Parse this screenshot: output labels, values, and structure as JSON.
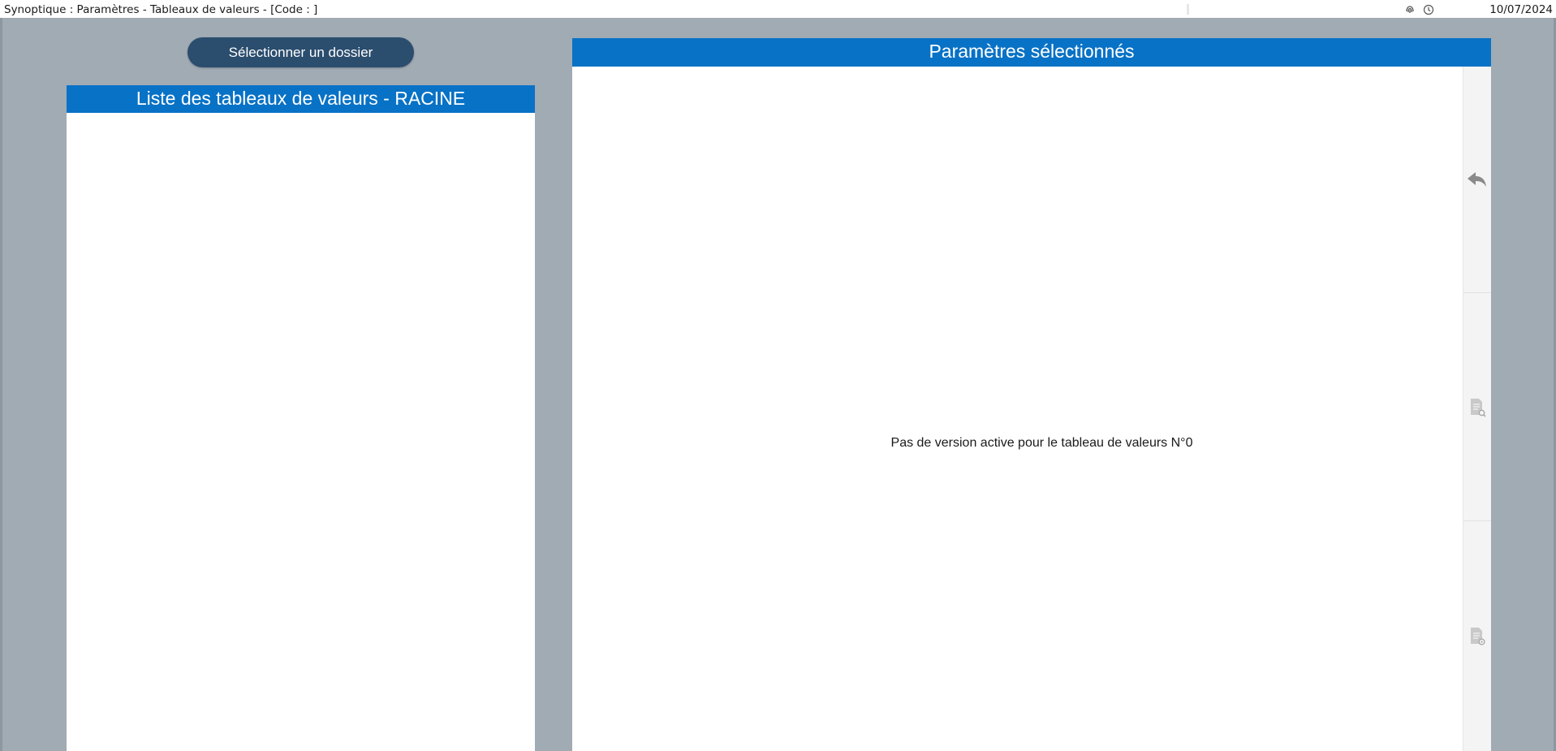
{
  "window": {
    "title": "Synoptique : Paramètres - Tableaux de valeurs - [Code : ]",
    "date": "10/07/2024",
    "icons": [
      "fingerprint-icon",
      "clock-icon"
    ]
  },
  "left": {
    "select_folder_label": "Sélectionner un dossier",
    "panel_title": "Liste des tableaux de valeurs - RACINE"
  },
  "right": {
    "panel_title": "Paramètres sélectionnés",
    "empty_message": "Pas de version active pour le tableau de valeurs N°0",
    "toolbar": [
      "undo-icon",
      "document-search-icon",
      "document-settings-icon"
    ]
  },
  "colors": {
    "header_blue": "#0872c6",
    "button_navy": "#2b4d6e",
    "background_gray": "#a1abb4"
  }
}
